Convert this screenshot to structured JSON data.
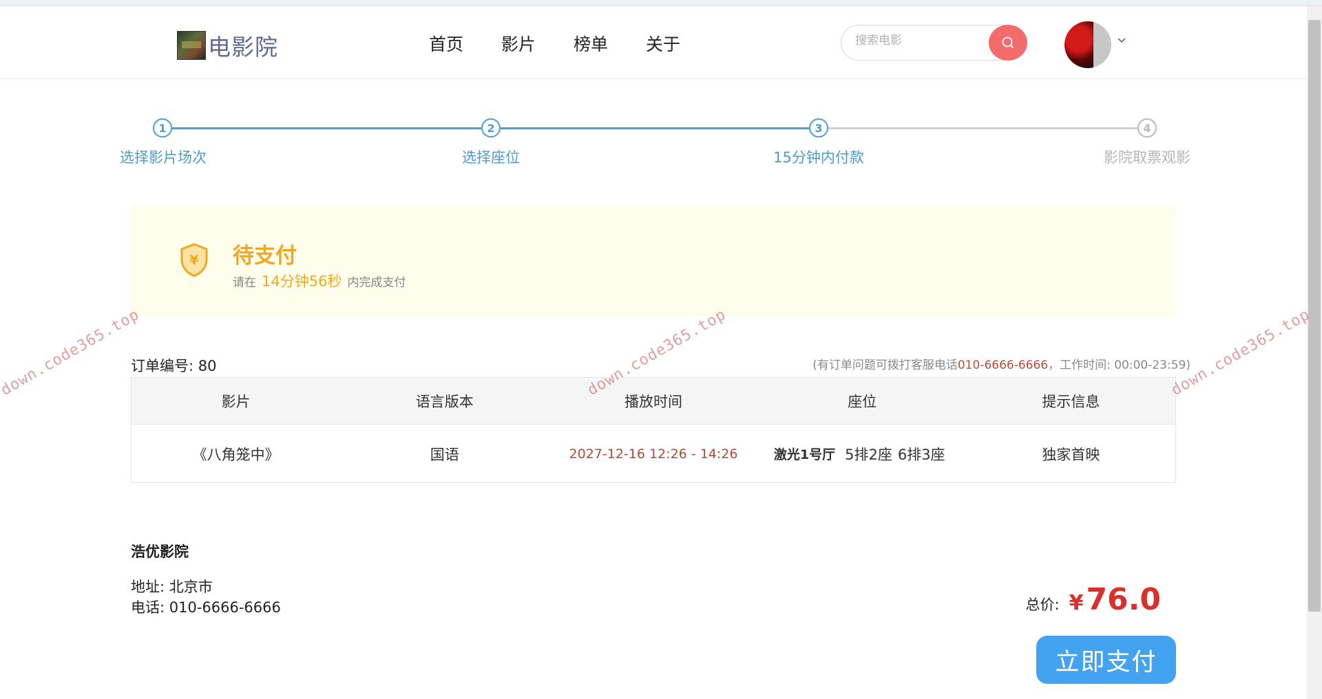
{
  "header": {
    "logo_text": "电影院",
    "nav": [
      "首页",
      "影片",
      "榜单",
      "关于"
    ],
    "search_placeholder": "搜索电影"
  },
  "steps": [
    {
      "num": "1",
      "label": "选择影片场次",
      "done": true
    },
    {
      "num": "2",
      "label": "选择座位",
      "done": true
    },
    {
      "num": "3",
      "label": "15分钟内付款",
      "done": true
    },
    {
      "num": "4",
      "label": "影院取票观影",
      "done": false
    }
  ],
  "banner": {
    "title": "待支付",
    "prefix": "请在",
    "time": "14分钟56秒",
    "suffix": "内完成支付"
  },
  "order": {
    "number": "订单编号: 80",
    "hint_prefix": "(有订单问题可拨打客服电话",
    "hint_phone": "010-6666-6666",
    "hint_suffix": "，工作时间: 00:00-23:59)",
    "columns": [
      "影片",
      "语言版本",
      "播放时间",
      "座位",
      "提示信息"
    ],
    "row": {
      "movie": "《八角笼中》",
      "language": "国语",
      "showtime": "2027-12-16 12:26 - 14:26",
      "hall": "激光1号厅",
      "seats": [
        "5排2座",
        "6排3座"
      ],
      "note": "独家首映"
    }
  },
  "cinema": {
    "name": "浩优影院",
    "address": "地址: 北京市",
    "phone": "电话: 010-6666-6666"
  },
  "total": {
    "label": "总价:",
    "currency": "¥",
    "value": "76.0"
  },
  "pay_button": "立即支付",
  "watermark": "down.code365.top",
  "colors": {
    "step_active": "#4aa0cf",
    "warning": "#f0a91e",
    "price": "#d9302b",
    "pay_button": "#43a3f0",
    "search_button": "#f36b6b"
  }
}
